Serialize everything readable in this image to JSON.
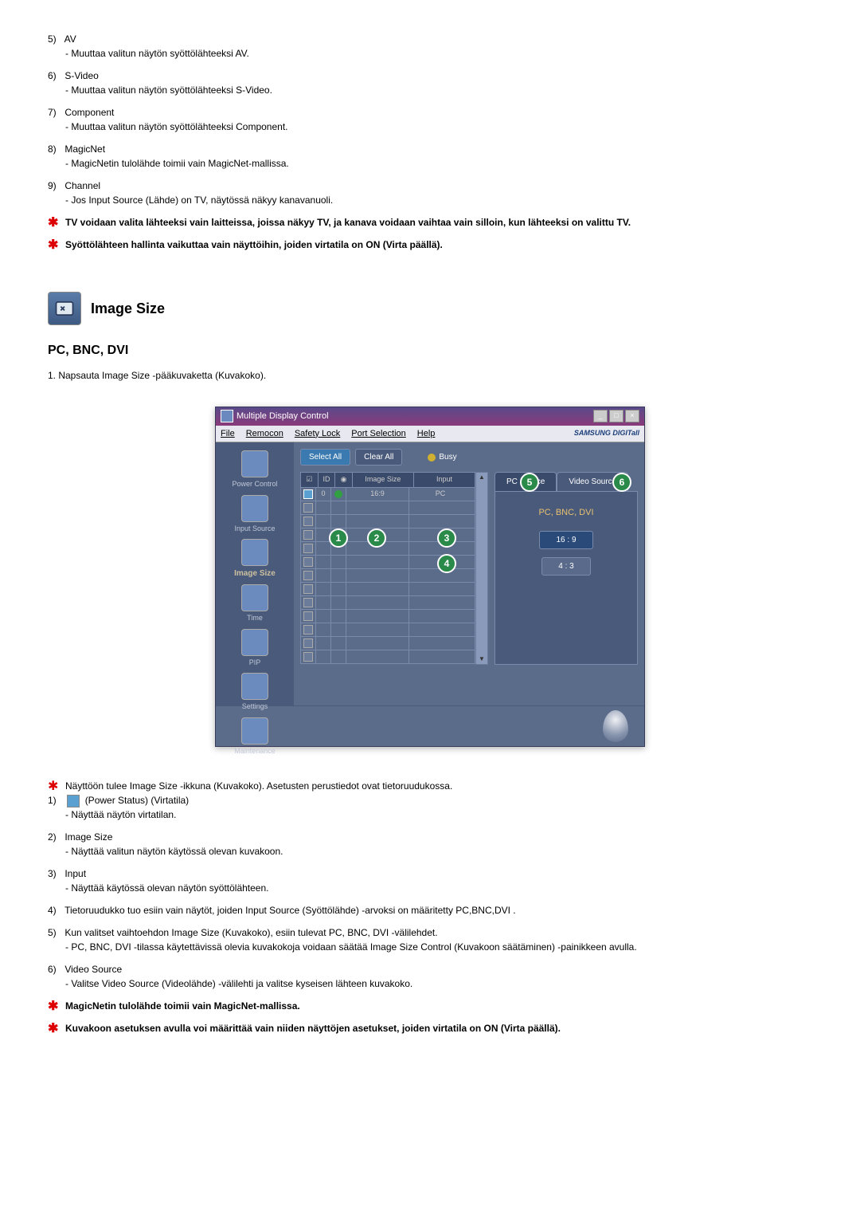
{
  "top_list": [
    {
      "num": "5)",
      "title": "AV",
      "desc": "- Muuttaa valitun näytön syöttölähteeksi AV."
    },
    {
      "num": "6)",
      "title": "S-Video",
      "desc": "- Muuttaa valitun näytön syöttölähteeksi S-Video."
    },
    {
      "num": "7)",
      "title": "Component",
      "desc": "- Muuttaa valitun näytön syöttölähteeksi Component."
    },
    {
      "num": "8)",
      "title": "MagicNet",
      "desc": "- MagicNetin tulolähde toimii vain MagicNet-mallissa."
    },
    {
      "num": "9)",
      "title": "Channel",
      "desc": "- Jos Input Source (Lähde) on TV, näytössä näkyy kanavanuoli."
    }
  ],
  "top_notes": [
    "TV voidaan valita lähteeksi vain laitteissa, joissa näkyy TV, ja kanava voidaan vaihtaa vain silloin, kun lähteeksi on valittu TV.",
    "Syöttölähteen hallinta vaikuttaa vain näyttöihin, joiden virtatila on ON (Virta päällä)."
  ],
  "section": {
    "heading": "Image Size",
    "subheading": "PC, BNC, DVI",
    "intro": "1. Napsauta Image Size -pääkuvaketta (Kuvakoko)."
  },
  "app": {
    "title": "Multiple Display Control",
    "menu": [
      "File",
      "Remocon",
      "Safety Lock",
      "Port Selection",
      "Help"
    ],
    "brand": "SAMSUNG DIGITall",
    "sidebar": [
      {
        "label": "Power Control",
        "active": false
      },
      {
        "label": "Input Source",
        "active": false
      },
      {
        "label": "Image Size",
        "active": true
      },
      {
        "label": "Time",
        "active": false
      },
      {
        "label": "PIP",
        "active": false
      },
      {
        "label": "Settings",
        "active": false
      },
      {
        "label": "Maintenance",
        "active": false
      }
    ],
    "buttons": {
      "select_all": "Select All",
      "clear_all": "Clear All",
      "busy": "Busy"
    },
    "table": {
      "headers": {
        "chk": "",
        "id": "ID",
        "pow": "",
        "size": "Image Size",
        "input": "Input"
      },
      "row1": {
        "id": "0",
        "size": "16:9",
        "input": "PC"
      }
    },
    "tabs": {
      "pc_source": "PC Source",
      "video_source": "Video Source"
    },
    "panel": {
      "label": "PC, BNC, DVI",
      "opt1": "16 : 9",
      "opt2": "4 : 3"
    },
    "callouts": {
      "c1": "1",
      "c2": "2",
      "c3": "3",
      "c4": "4",
      "c5": "5",
      "c6": "6"
    }
  },
  "bottom_star_intro": "Näyttöön tulee Image Size -ikkuna (Kuvakoko). Asetusten perustiedot ovat tietoruudukossa.",
  "bottom_list": [
    {
      "num": "1)",
      "title_prefix": "",
      "title_suffix": "(Power Status) (Virtatila)",
      "desc": "- Näyttää näytön virtatilan.",
      "has_icon": true
    },
    {
      "num": "2)",
      "title": "Image Size",
      "desc": "- Näyttää valitun näytön käytössä olevan kuvakoon."
    },
    {
      "num": "3)",
      "title": "Input",
      "desc": "- Näyttää käytössä olevan näytön syöttölähteen."
    },
    {
      "num": "4)",
      "title": "Tietoruudukko tuo esiin vain näytöt, joiden Input Source (Syöttölähde) -arvoksi on määritetty PC,BNC,DVI .",
      "desc": ""
    },
    {
      "num": "5)",
      "title": "Kun valitset vaihtoehdon Image Size (Kuvakoko), esiin tulevat PC, BNC, DVI -välilehdet.",
      "desc": "- PC, BNC, DVI -tilassa käytettävissä olevia kuvakokoja voidaan säätää Image Size Control (Kuvakoon säätäminen) -painikkeen avulla."
    },
    {
      "num": "6)",
      "title": "Video Source",
      "desc": "- Valitse Video Source (Videolähde) -välilehti ja valitse kyseisen lähteen kuvakoko."
    }
  ],
  "bottom_notes": [
    "MagicNetin tulolähde toimii vain MagicNet-mallissa.",
    "Kuvakoon asetuksen avulla voi määrittää vain niiden näyttöjen asetukset, joiden virtatila on ON (Virta päällä)."
  ]
}
